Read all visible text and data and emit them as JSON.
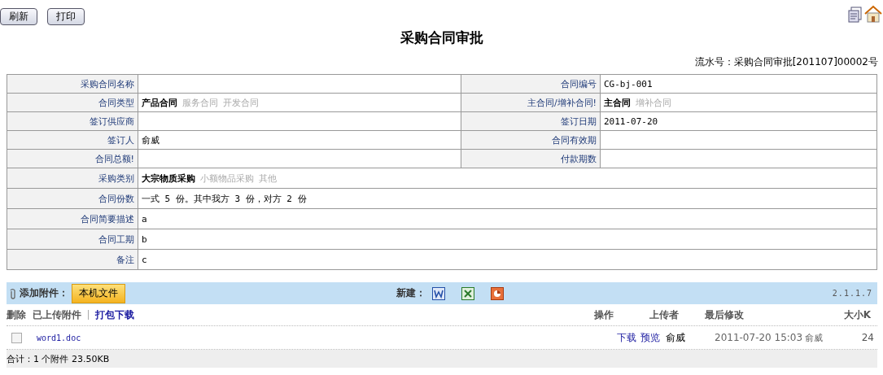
{
  "toolbar": {
    "buttons": [
      "刷新",
      "打印"
    ]
  },
  "title": "采购合同审批",
  "serial": "流水号：采购合同审批[201107]00002号",
  "form": {
    "rows": [
      {
        "cells": [
          {
            "label": "采购合同名称",
            "kind": "text"
          },
          {
            "label": "合同编号",
            "kind": "text",
            "value": "CG-bj-001"
          }
        ]
      },
      {
        "cells": [
          {
            "label": "合同类型",
            "kind": "options",
            "options": [
              {
                "label": "产品合同",
                "selected": true
              },
              {
                "label": "服务合同",
                "selected": false
              },
              {
                "label": "开发合同",
                "selected": false
              }
            ]
          },
          {
            "label": "主合同/增补合同!",
            "kind": "options",
            "options": [
              {
                "label": "主合同",
                "selected": true
              },
              {
                "label": "增补合同",
                "selected": false
              }
            ]
          }
        ]
      },
      {
        "cells": [
          {
            "label": "签订供应商",
            "kind": "text"
          },
          {
            "label": "签订日期",
            "kind": "text",
            "value": "2011-07-20"
          }
        ]
      },
      {
        "cells": [
          {
            "label": "签订人",
            "kind": "text",
            "value": "俞威"
          },
          {
            "label": "合同有效期",
            "kind": "text"
          }
        ]
      },
      {
        "cells": [
          {
            "label": "合同总额!",
            "kind": "text"
          },
          {
            "label": "付款期数",
            "kind": "text"
          }
        ]
      },
      {
        "cells": [
          {
            "label": "采购类别",
            "kind": "options",
            "options": [
              {
                "label": "大宗物质采购",
                "selected": true
              },
              {
                "label": "小额物品采购",
                "selected": false
              },
              {
                "label": "其他",
                "selected": false
              }
            ]
          }
        ]
      },
      {
        "cells": [
          {
            "label": "合同份数",
            "kind": "text",
            "value": "一式 5 份。其中我方 3 份，对方 2 份"
          }
        ]
      },
      {
        "cells": [
          {
            "label": "合同简要描述",
            "kind": "text",
            "value": "a"
          }
        ]
      },
      {
        "cells": [
          {
            "label": "合同工期",
            "kind": "text",
            "value": "b"
          }
        ]
      },
      {
        "cells": [
          {
            "label": "备注",
            "kind": "text",
            "value": "c"
          }
        ]
      }
    ]
  },
  "attachments": {
    "add_label": "添加附件：",
    "local_button": "本机文件",
    "new_label": "新建：",
    "version": "2.1.1.7",
    "delete": "删除",
    "uploaded": "已上传附件",
    "pack_download": "打包下载",
    "columns": [
      "操作",
      "上传者",
      "最后修改",
      "大小K"
    ],
    "files": [
      {
        "checked": false,
        "name": "word1.doc",
        "actions": [
          "下载",
          "预览"
        ],
        "uploader": "俞威",
        "modified": "2011-07-20 15:03",
        "modifier": "俞威",
        "size": "24"
      }
    ],
    "total": "合计：1 个附件 23.50KB"
  }
}
